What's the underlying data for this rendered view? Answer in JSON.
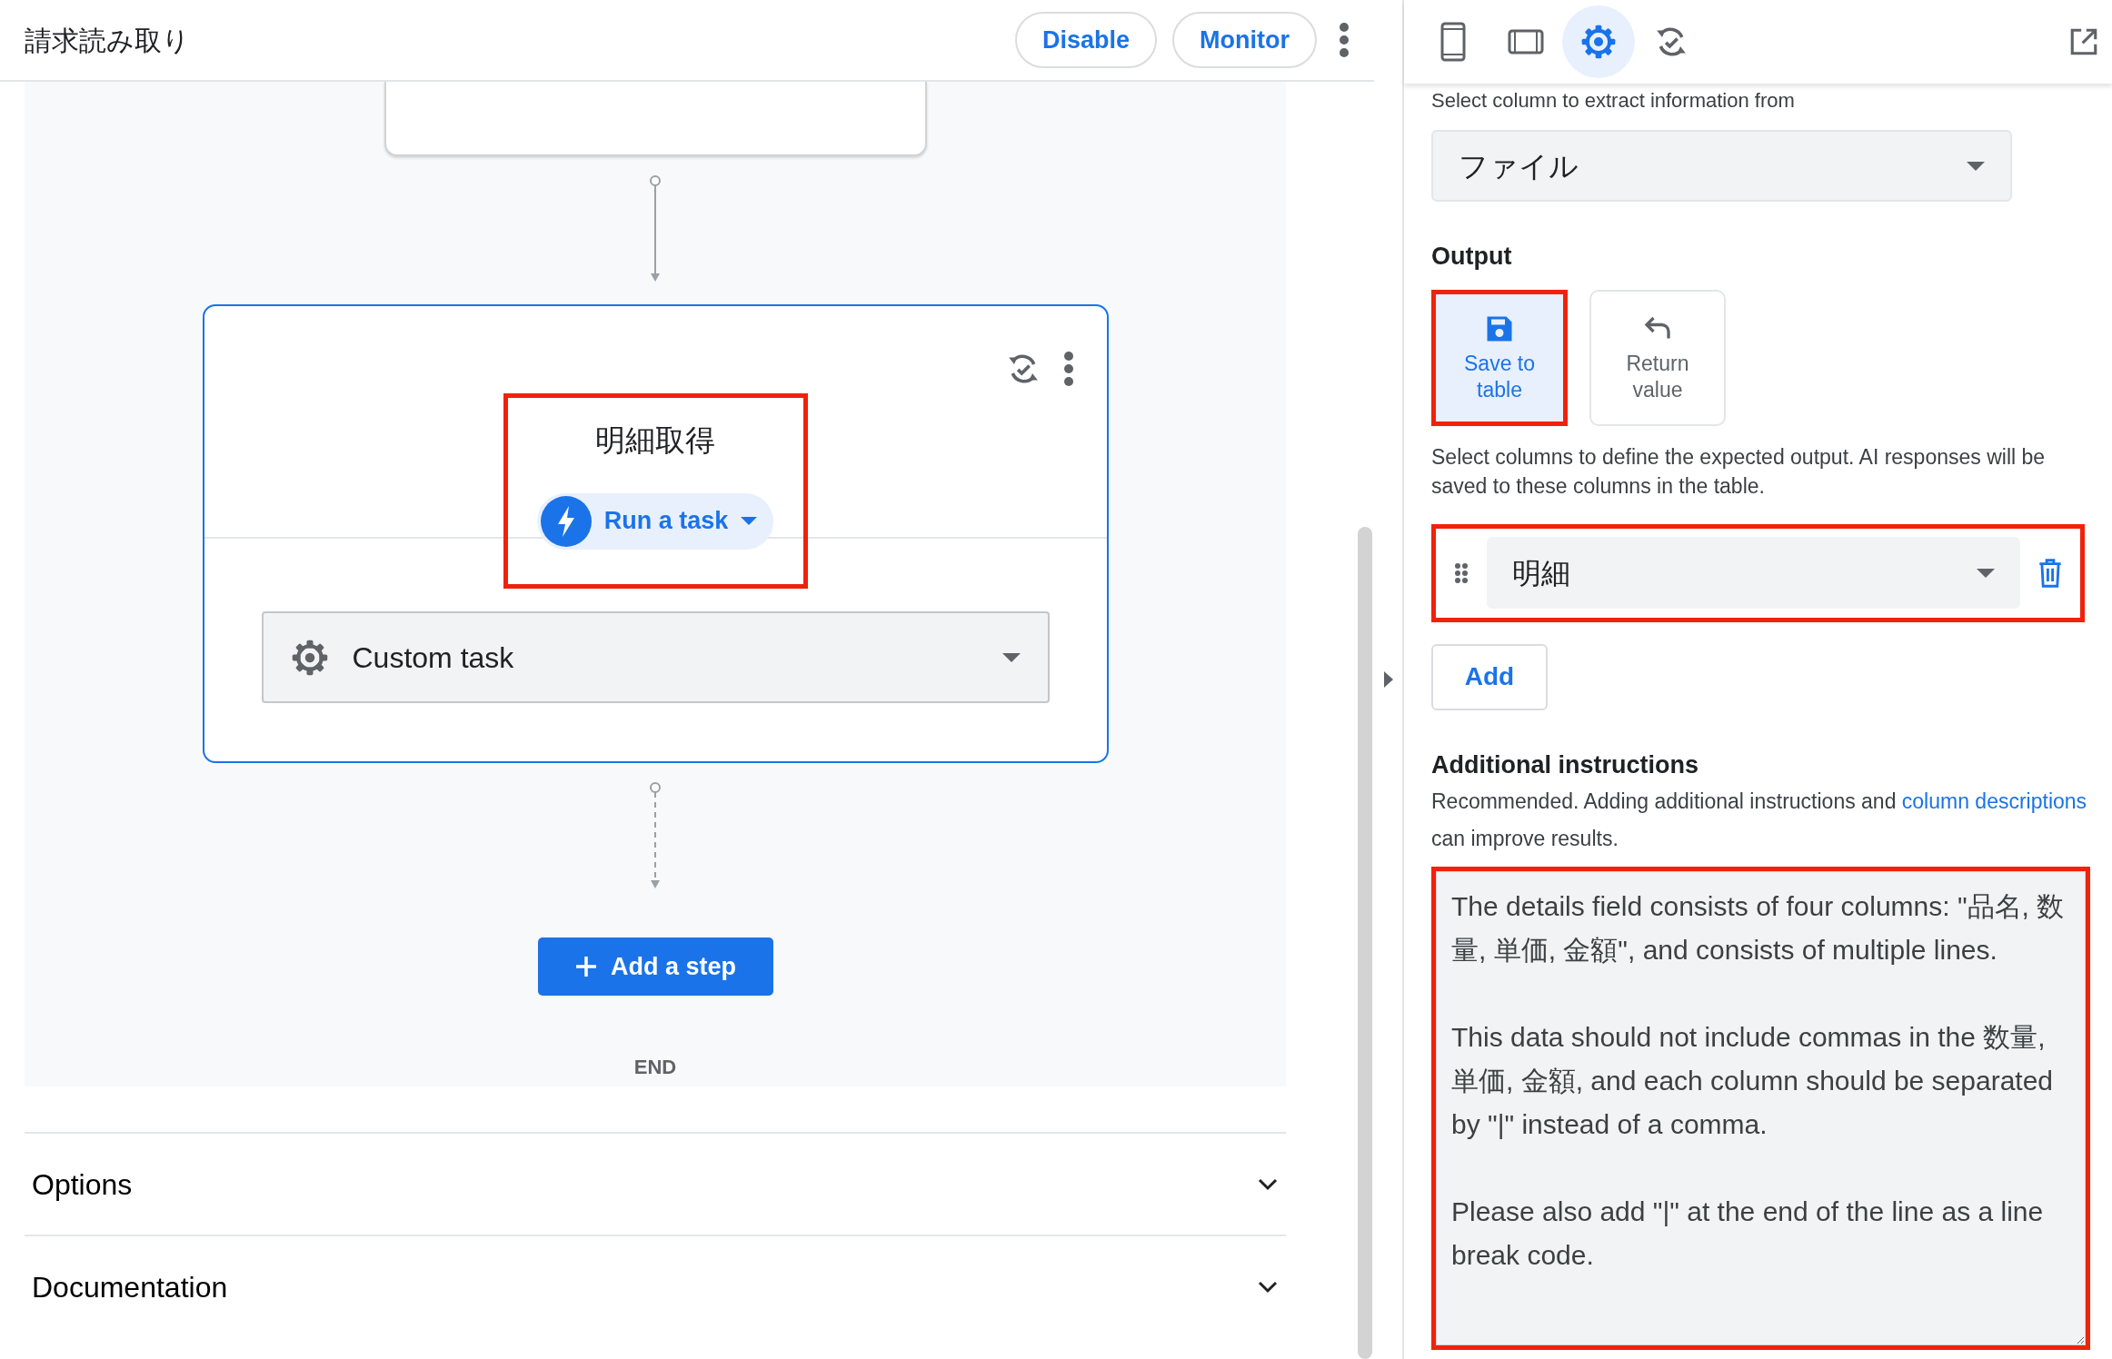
{
  "header": {
    "title": "請求読み取り",
    "buttons": [
      {
        "label": "Disable"
      },
      {
        "label": "Monitor"
      }
    ]
  },
  "canvas": {
    "step": {
      "title": "明細取得",
      "highlighted": true,
      "action": "Run a task",
      "task_type": "Custom task"
    },
    "add_step": "Add a step",
    "end_label": "END"
  },
  "sections": [
    {
      "label": "Options",
      "expanded": false
    },
    {
      "label": "Documentation",
      "expanded": false
    }
  ],
  "panel": {
    "tabs": [
      {
        "kind": "mobile",
        "selected": false
      },
      {
        "kind": "tablet",
        "selected": false
      },
      {
        "kind": "settings",
        "selected": true
      },
      {
        "kind": "sync",
        "selected": false
      }
    ],
    "source_column": {
      "label": "Select column to extract information from",
      "value": "ファイル"
    },
    "output": {
      "label": "Output",
      "options": [
        {
          "kind": "save",
          "label": "Save to table",
          "selected": true,
          "highlighted": true
        },
        {
          "kind": "return",
          "label": "Return value",
          "selected": false,
          "highlighted": false
        }
      ],
      "description": "Select columns to define the expected output. AI responses will be saved to these columns in the table.",
      "columns": [
        {
          "value": "明細",
          "highlighted": true
        }
      ],
      "add_button": "Add"
    },
    "instructions": {
      "label": "Additional instructions",
      "hint_before": "Recommended. Adding additional instructions and",
      "hint_link": "column descriptions",
      "hint_after": "can improve results.",
      "value": "The details field consists of four columns: \"品名, 数量, 単価, 金額\", and consists of multiple lines.\n\nThis data should not include commas in the 数量, 単価, 金額, and each column should be separated by \"|\" instead of a comma.\n\nPlease also add \"|\" at the end of the line as a line break code.",
      "highlighted": true
    }
  }
}
